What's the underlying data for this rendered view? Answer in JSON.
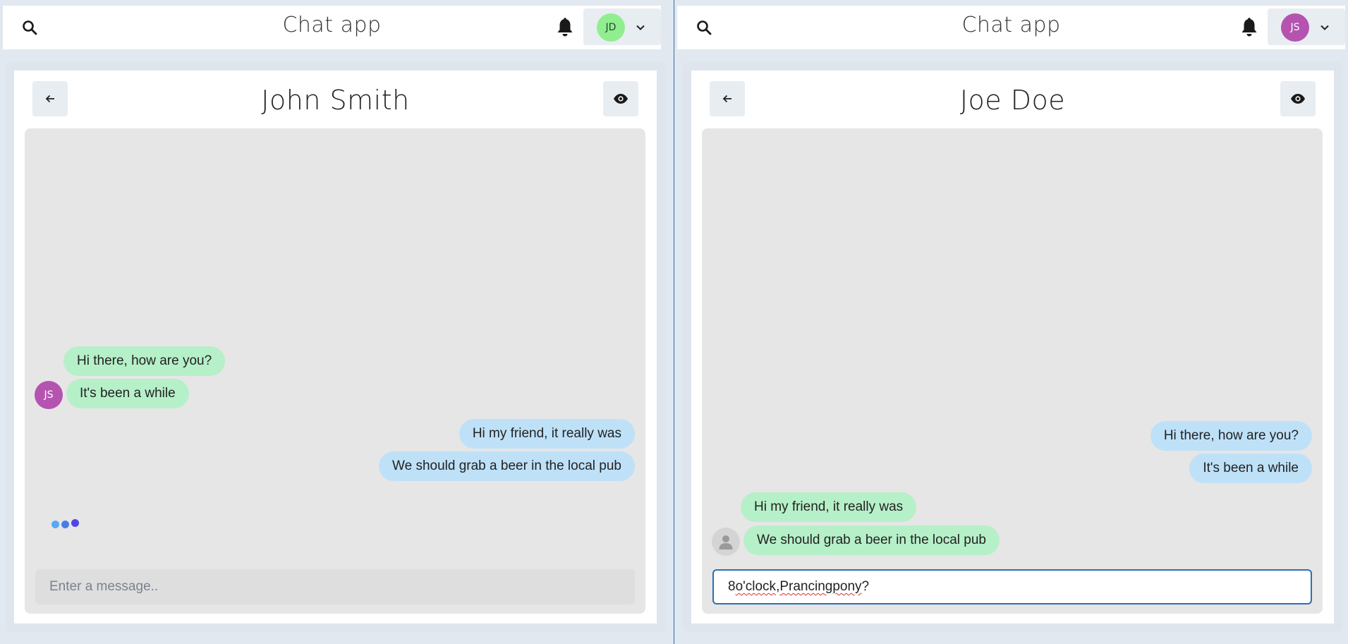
{
  "left": {
    "app_title": "Chat app",
    "user_initials": "JD",
    "user_avatar_color": "#90ee90",
    "chat_title": "John Smith",
    "messages": [
      {
        "text": "Hi there, how are you?",
        "side": "incoming"
      },
      {
        "text": "It's been a while",
        "side": "incoming"
      },
      {
        "text": "Hi my friend, it really was",
        "side": "outgoing"
      },
      {
        "text": "We should grab a beer in the local pub",
        "side": "outgoing"
      }
    ],
    "contact_initials": "JS",
    "contact_avatar_color": "#b553b0",
    "input_placeholder": "Enter a message..",
    "typing_indicator": true
  },
  "right": {
    "app_title": "Chat app",
    "user_initials": "JS",
    "user_avatar_color": "#b553b0",
    "chat_title": "Joe Doe",
    "messages": [
      {
        "text": "Hi there, how are you?",
        "side": "outgoing"
      },
      {
        "text": "It's been a while",
        "side": "outgoing"
      },
      {
        "text": "Hi my friend, it really was",
        "side": "incoming"
      },
      {
        "text": "We should grab a beer in the local pub",
        "side": "incoming"
      }
    ],
    "input_value_parts": [
      "8 ",
      "o'clock",
      ", ",
      "Prancing",
      " ",
      "pony",
      "?"
    ]
  },
  "colors": {
    "incoming_bubble": "#b6f0c8",
    "outgoing_bubble": "#bee1f8",
    "chat_background": "#e6e6e6",
    "typing_dots": [
      "#5aa8f5",
      "#4b7ce6",
      "#4f46e5"
    ]
  }
}
